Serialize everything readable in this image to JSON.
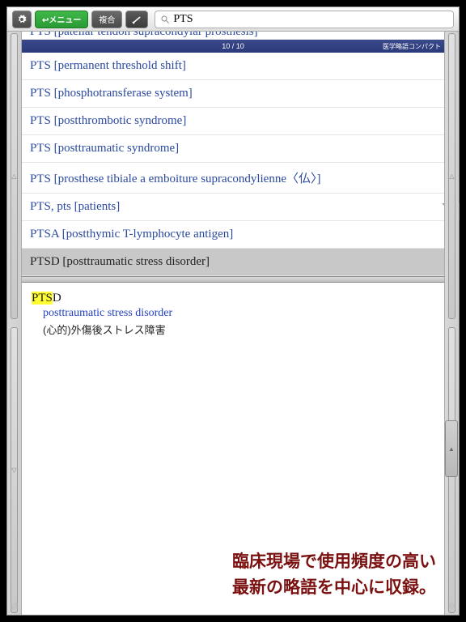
{
  "toolbar": {
    "menu_label": "↩メニュー",
    "mode_label": "複合",
    "search_value": "PTS"
  },
  "status": {
    "counter": "10 / 10",
    "source": "医学略語コンパクト"
  },
  "clipped_row": "PTS [patellar tendon supracondylar prosthesis]",
  "results": [
    "PTS [permanent threshold shift]",
    "PTS [phosphotransferase system]",
    "PTS [postthrombotic syndrome]",
    "PTS [posttraumatic syndrome]",
    "PTS [prosthese tibiale a emboiture supracondylienne〈仏〉]",
    "PTS, pts [patients]",
    "PTSA [postthymic T-lymphocyte antigen]",
    "PTSD [posttraumatic stress disorder]"
  ],
  "selected_index": 7,
  "detail": {
    "highlight": "PTS",
    "rest": "D",
    "english": "posttraumatic stress disorder",
    "japanese": "(心的)外傷後ストレス障害"
  },
  "promo": {
    "line1": "臨床現場で使用頻度の高い",
    "line2": "最新の略語を中心に収録。"
  }
}
